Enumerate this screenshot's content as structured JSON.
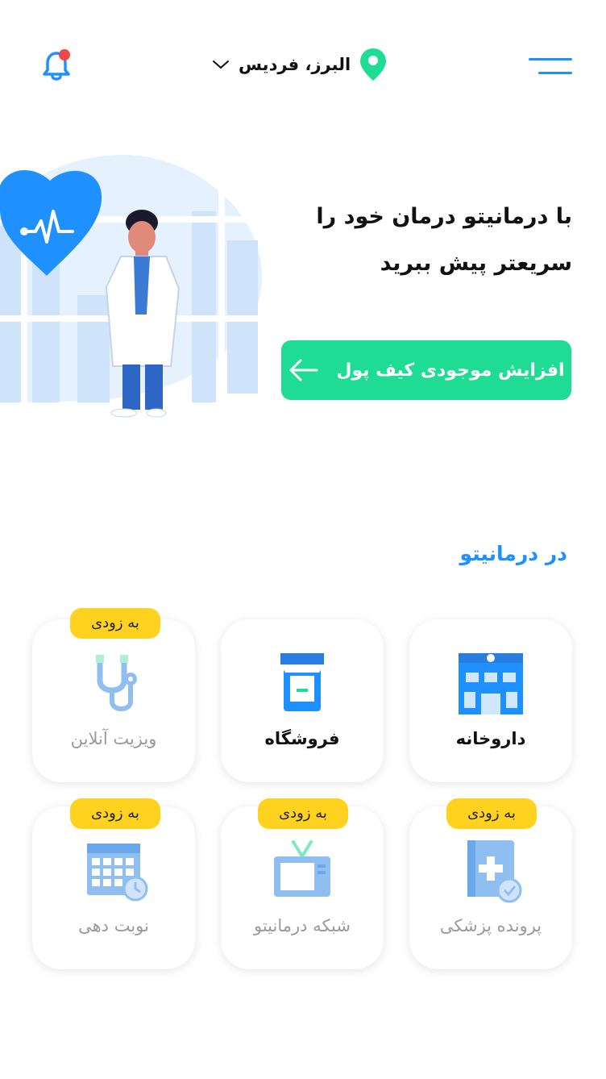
{
  "header": {
    "location": "البرز، فردیس",
    "icons": {
      "menu": "hamburger-menu-icon",
      "location": "location-pin-icon",
      "dropdown": "chevron-down-icon",
      "notification": "bell-icon"
    }
  },
  "hero": {
    "title_line1": "با درمانیتو درمان خود را",
    "title_line2": "سریعتر پیش ببرید",
    "cta_label": "افزایش موجودی کیف پول"
  },
  "section": {
    "title": "در درمانیتو"
  },
  "services": [
    {
      "label": "داروخانه",
      "badge": "",
      "icon": "pharmacy-icon",
      "active": true
    },
    {
      "label": "فروشگاه",
      "badge": "",
      "icon": "shop-icon",
      "active": true
    },
    {
      "label": "ویزیت آنلاین",
      "badge": "به زودی",
      "icon": "stethoscope-icon",
      "active": false
    },
    {
      "label": "پرونده پزشکی",
      "badge": "به زودی",
      "icon": "medical-record-icon",
      "active": false
    },
    {
      "label": "شبکه درمانیتو",
      "badge": "به زودی",
      "icon": "tv-icon",
      "active": false
    },
    {
      "label": "نوبت دهی",
      "badge": "به زودی",
      "icon": "calendar-icon",
      "active": false
    }
  ],
  "colors": {
    "primary": "#1e90ff",
    "accent": "#1fdc94",
    "badge": "#ffd21f",
    "notification_dot": "#f04848"
  }
}
